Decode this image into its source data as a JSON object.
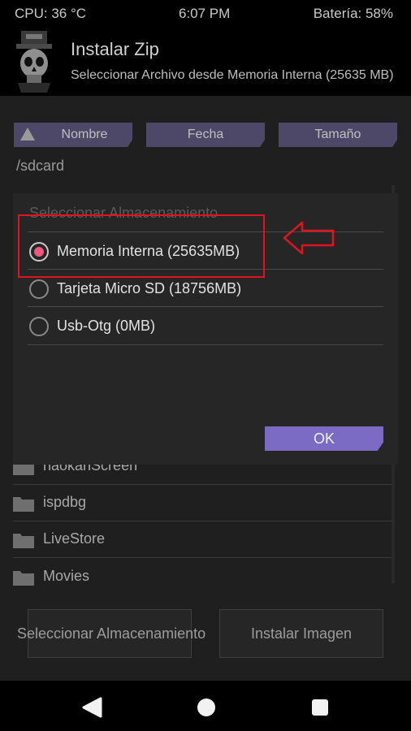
{
  "status": {
    "cpu": "CPU: 36 °C",
    "time": "6:07 PM",
    "battery": "Batería: 58%"
  },
  "header": {
    "title": "Instalar Zip",
    "subtitle": "Seleccionar Archivo desde Memoria Interna (25635 MB)"
  },
  "sort": {
    "name": "Nombre",
    "date": "Fecha",
    "size": "Tamaño"
  },
  "path": "/sdcard",
  "files": [
    "haokanScreen",
    "ispdbg",
    "LiveStore",
    "Movies"
  ],
  "dialog": {
    "title": "Seleccionar Almacenamiento",
    "options": [
      "Memoria Interna (25635MB)",
      "Tarjeta Micro SD (18756MB)",
      "Usb-Otg (0MB)"
    ],
    "selected_index": 0,
    "ok": "OK"
  },
  "bottom": {
    "select_storage": "Seleccionar Almacenamiento",
    "install_image": "Instalar Imagen"
  },
  "colors": {
    "accent": "#7c6bc4",
    "radio_selected": "#e8597d",
    "annotation": "#e0141e"
  }
}
